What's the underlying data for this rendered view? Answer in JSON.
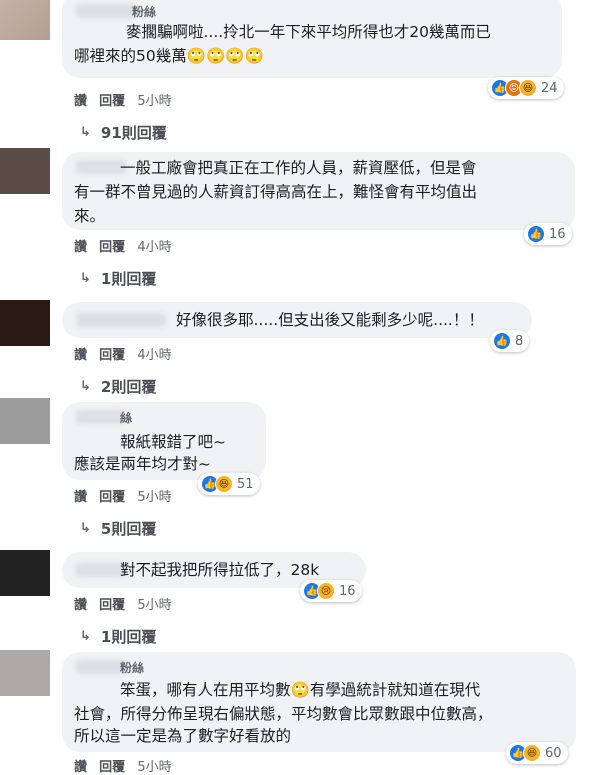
{
  "comments": [
    {
      "name_tail": "粉絲",
      "lines": [
        "麥擱騙啊啦....拎北一年下來平均所得也才20幾萬而已",
        "哪裡來的50幾萬🙄🙄🙄🙄"
      ],
      "reactions": [
        "like",
        "angry",
        "haha"
      ],
      "count": "24",
      "like_label": "讚",
      "reply_label": "回覆",
      "time": "5小時",
      "replies": "91則回覆"
    },
    {
      "name_tail": "",
      "lines": [
        "一般工廠會把真正在工作的人員，薪資壓低，但是會",
        "有一群不曾見過的人薪資訂得高高在上，難怪會有平均值出",
        "來。"
      ],
      "reactions": [
        "like"
      ],
      "count": "16",
      "like_label": "讚",
      "reply_label": "回覆",
      "time": "4小時",
      "replies": "1則回覆"
    },
    {
      "name_tail": "",
      "lines": [
        "好像很多耶.....但支出後又能剩多少呢....！！"
      ],
      "reactions": [
        "like"
      ],
      "count": "8",
      "like_label": "讚",
      "reply_label": "回覆",
      "time": "4小時",
      "replies": "2則回覆"
    },
    {
      "name_tail": "絲",
      "lines": [
        "報紙報錯了吧~",
        "應該是兩年均才對~"
      ],
      "reactions": [
        "like",
        "haha"
      ],
      "count": "51",
      "like_label": "讚",
      "reply_label": "回覆",
      "time": "5小時",
      "replies": "5則回覆"
    },
    {
      "name_tail": "",
      "lines": [
        "對不起我把所得拉低了，28k"
      ],
      "reactions": [
        "like",
        "sad"
      ],
      "count": "16",
      "like_label": "讚",
      "reply_label": "回覆",
      "time": "5小時",
      "replies": "1則回覆"
    },
    {
      "name_tail": "粉絲",
      "lines": [
        "笨蛋，哪有人在用平均數🙄有學過統計就知道在現代",
        "社會，所得分佈呈現右偏狀態，平均數會比眾數跟中位數高，",
        "所以這一定是為了數字好看放的"
      ],
      "reactions": [
        "like",
        "haha"
      ],
      "count": "60",
      "like_label": "讚",
      "reply_label": "回覆",
      "time": "5小時",
      "replies": ""
    }
  ],
  "icons": {
    "like": "thumbs-up",
    "angry": "angry-face",
    "haha": "laughing-face",
    "sad": "crying-face",
    "reply_arrow": "reply-arrow-icon"
  }
}
